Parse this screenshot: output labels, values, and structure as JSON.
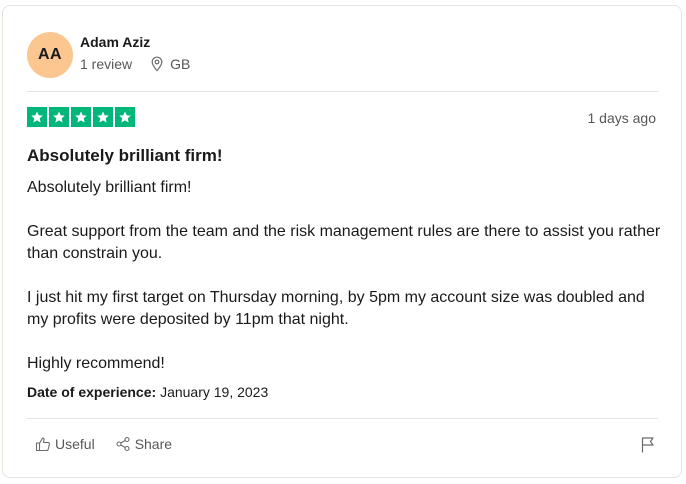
{
  "reviewer": {
    "initials": "AA",
    "name": "Adam Aziz",
    "reviews": "1 review",
    "country": "GB",
    "avatar_color": "#fcc690"
  },
  "rating": {
    "stars": 5,
    "max_stars": 5,
    "star_color": "#00b67a"
  },
  "review": {
    "date_ago": "1 days ago",
    "title": "Absolutely brilliant firm!",
    "paragraphs": [
      "Absolutely brilliant firm!",
      "Great support from the team and the risk management rules are there to assist you rather than constrain you.",
      "I just hit my first target on Thursday morning, by 5pm my account size was doubled and my profits were deposited by 11pm that night.",
      "Highly recommend!"
    ],
    "experience_label": "Date of experience:",
    "experience_date": "January 19, 2023"
  },
  "actions": {
    "useful_label": "Useful",
    "share_label": "Share",
    "useful_icon": "thumbs-up-icon",
    "share_icon": "share-icon",
    "flag_icon": "flag-icon"
  }
}
